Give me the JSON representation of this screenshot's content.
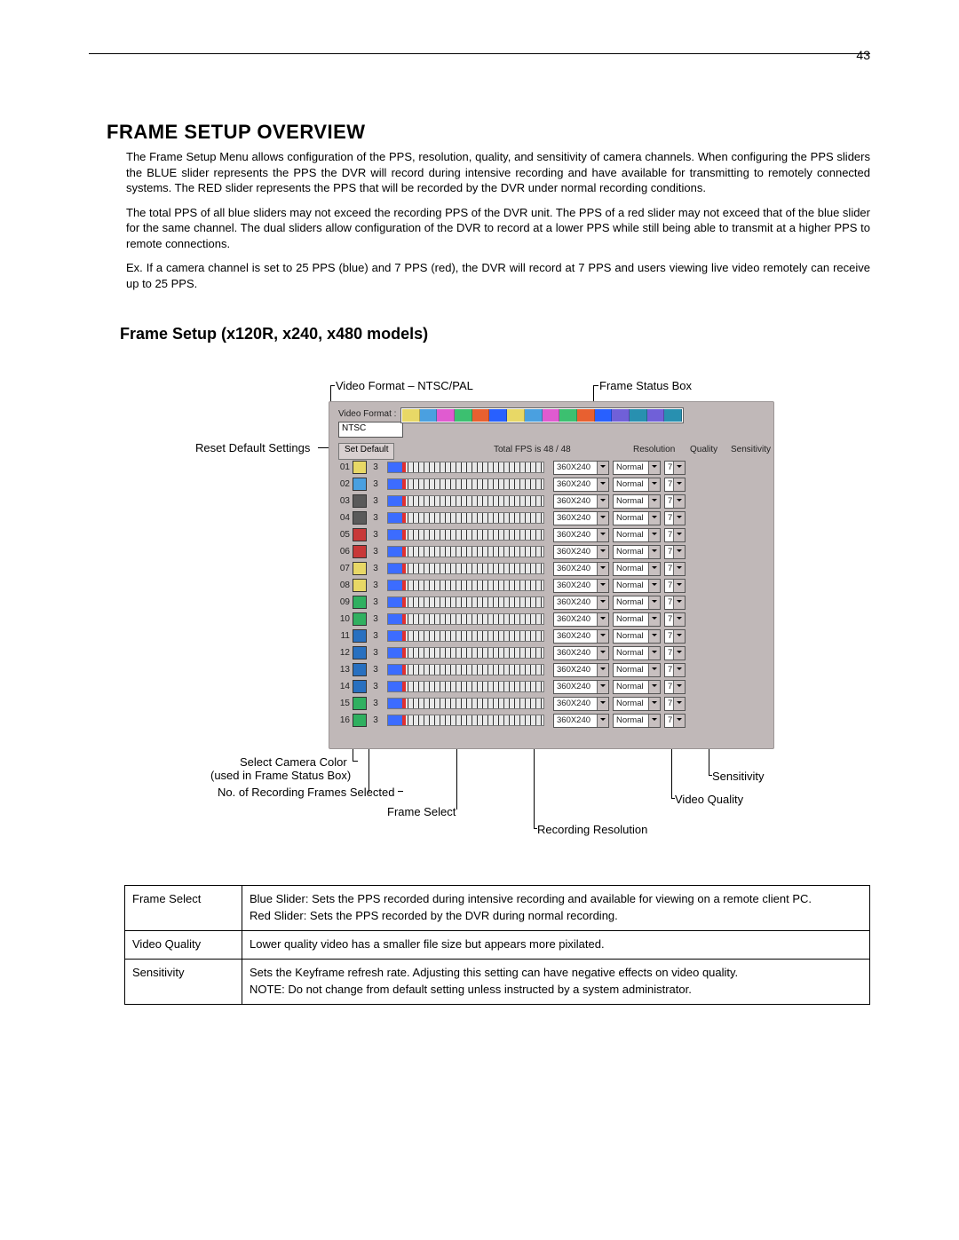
{
  "page_number": "43",
  "title": "FRAME SETUP OVERVIEW",
  "paragraphs": {
    "p1": "The Frame Setup Menu allows configuration of the PPS, resolution, quality, and sensitivity of camera channels. When configuring the PPS sliders the BLUE slider represents the PPS the DVR will record during intensive recording and have available for transmitting to remotely connected systems. The RED slider represents the PPS that will be recorded by the DVR under normal recording conditions.",
    "p2": "The total PPS of all blue sliders may not exceed the recording PPS of the DVR unit. The PPS of a red slider may not exceed that of the blue slider for the same channel. The dual sliders allow configuration of the DVR to record at a lower PPS while still being able to transmit at a higher PPS to remote connections.",
    "p3": "Ex. If a camera channel is set to 25 PPS (blue) and 7 PPS (red), the DVR will record at 7 PPS and users viewing live video remotely can receive up to 25 PPS."
  },
  "subtitle": "Frame Setup (x120R, x240, x480 models)",
  "panel": {
    "video_format_label": "Video Format :",
    "video_format_value": "NTSC",
    "set_default": "Set Default",
    "total_fps": "Total FPS is 48 / 48",
    "headers": {
      "res": "Resolution",
      "qual": "Quality",
      "sen": "Sensitivity"
    }
  },
  "frame_box_colors": [
    "#e8d866",
    "#4aa0e0",
    "#e05bd0",
    "#3cc070",
    "#e86030",
    "#2860ff",
    "#e8d866",
    "#4aa0e0",
    "#e05bd0",
    "#3cc070",
    "#e86030",
    "#2860ff",
    "#7060d8",
    "#2890b0",
    "#7060d8",
    "#2890b0"
  ],
  "channels": [
    {
      "num": "01",
      "color": "#e8d866",
      "frames": "3",
      "res": "360X240",
      "qual": "Normal",
      "sen": "7"
    },
    {
      "num": "02",
      "color": "#4aa0e0",
      "frames": "3",
      "res": "360X240",
      "qual": "Normal",
      "sen": "7"
    },
    {
      "num": "03",
      "color": "#5a5a5a",
      "frames": "3",
      "res": "360X240",
      "qual": "Normal",
      "sen": "7"
    },
    {
      "num": "04",
      "color": "#5a5a5a",
      "frames": "3",
      "res": "360X240",
      "qual": "Normal",
      "sen": "7"
    },
    {
      "num": "05",
      "color": "#c83838",
      "frames": "3",
      "res": "360X240",
      "qual": "Normal",
      "sen": "7"
    },
    {
      "num": "06",
      "color": "#c83838",
      "frames": "3",
      "res": "360X240",
      "qual": "Normal",
      "sen": "7"
    },
    {
      "num": "07",
      "color": "#e8d866",
      "frames": "3",
      "res": "360X240",
      "qual": "Normal",
      "sen": "7"
    },
    {
      "num": "08",
      "color": "#e8d866",
      "frames": "3",
      "res": "360X240",
      "qual": "Normal",
      "sen": "7"
    },
    {
      "num": "09",
      "color": "#30b060",
      "frames": "3",
      "res": "360X240",
      "qual": "Normal",
      "sen": "7"
    },
    {
      "num": "10",
      "color": "#30b060",
      "frames": "3",
      "res": "360X240",
      "qual": "Normal",
      "sen": "7"
    },
    {
      "num": "11",
      "color": "#2870c0",
      "frames": "3",
      "res": "360X240",
      "qual": "Normal",
      "sen": "7"
    },
    {
      "num": "12",
      "color": "#2870c0",
      "frames": "3",
      "res": "360X240",
      "qual": "Normal",
      "sen": "7"
    },
    {
      "num": "13",
      "color": "#2870c0",
      "frames": "3",
      "res": "360X240",
      "qual": "Normal",
      "sen": "7"
    },
    {
      "num": "14",
      "color": "#2870c0",
      "frames": "3",
      "res": "360X240",
      "qual": "Normal",
      "sen": "7"
    },
    {
      "num": "15",
      "color": "#30b060",
      "frames": "3",
      "res": "360X240",
      "qual": "Normal",
      "sen": "7"
    },
    {
      "num": "16",
      "color": "#30b060",
      "frames": "3",
      "res": "360X240",
      "qual": "Normal",
      "sen": "7"
    }
  ],
  "callouts": {
    "video_format": "Video Format – NTSC/PAL",
    "frame_status_box": "Frame Status Box",
    "reset_default": "Reset Default Settings",
    "select_color_l1": "Select Camera Color",
    "select_color_l2": "(used in Frame Status Box)",
    "num_frames": "No. of Recording Frames Selected",
    "frame_select": "Frame Select",
    "recording_res": "Recording Resolution",
    "video_quality": "Video Quality",
    "sensitivity": "Sensitivity"
  },
  "defs": {
    "frame_select_label": "Frame Select",
    "frame_select_text": "Blue Slider: Sets the PPS recorded during intensive recording and available for viewing on a remote client PC.\nRed Slider: Sets the PPS recorded by the DVR during normal recording.",
    "video_quality_label": "Video Quality",
    "video_quality_text": "Lower quality video has a smaller file size but appears more pixilated.",
    "sensitivity_label": "Sensitivity",
    "sensitivity_text": "Sets the Keyframe refresh rate.  Adjusting this setting can have negative effects on video quality.\nNOTE:  Do not change from default setting unless instructed by a system administrator."
  }
}
